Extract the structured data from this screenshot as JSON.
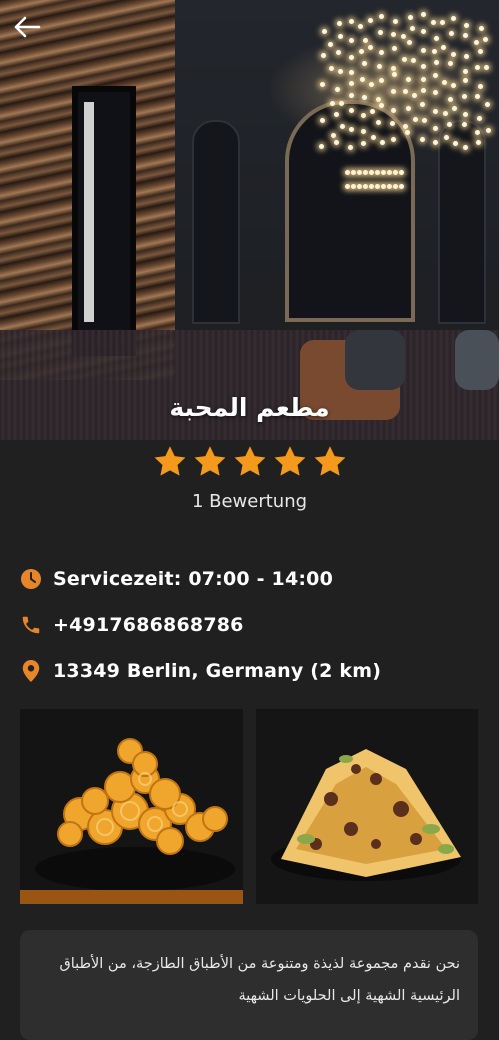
{
  "restaurant": {
    "name": "مطعم المحبة",
    "rating_value": 5,
    "rating_max": 5,
    "rating_count_text": "1 Bewertung"
  },
  "info": {
    "service_time": "Servicezeit: 07:00 - 14:00",
    "phone": "+4917686868786",
    "address": "13349 Berlin, Germany (2 km)"
  },
  "description": "نحن نقدم مجموعة لذيذة ومتنوعة من الأطباق الطازجة، من الأطباق الرئيسية الشهية إلى الحلويات الشهية",
  "colors": {
    "background": "#202020",
    "accent": "#e6852a",
    "star": "#f39a1d",
    "card": "#2e2e2e"
  },
  "icons": {
    "back": "arrow-left-icon",
    "clock": "clock-icon",
    "phone": "phone-icon",
    "location": "map-pin-icon",
    "star": "star-icon"
  }
}
